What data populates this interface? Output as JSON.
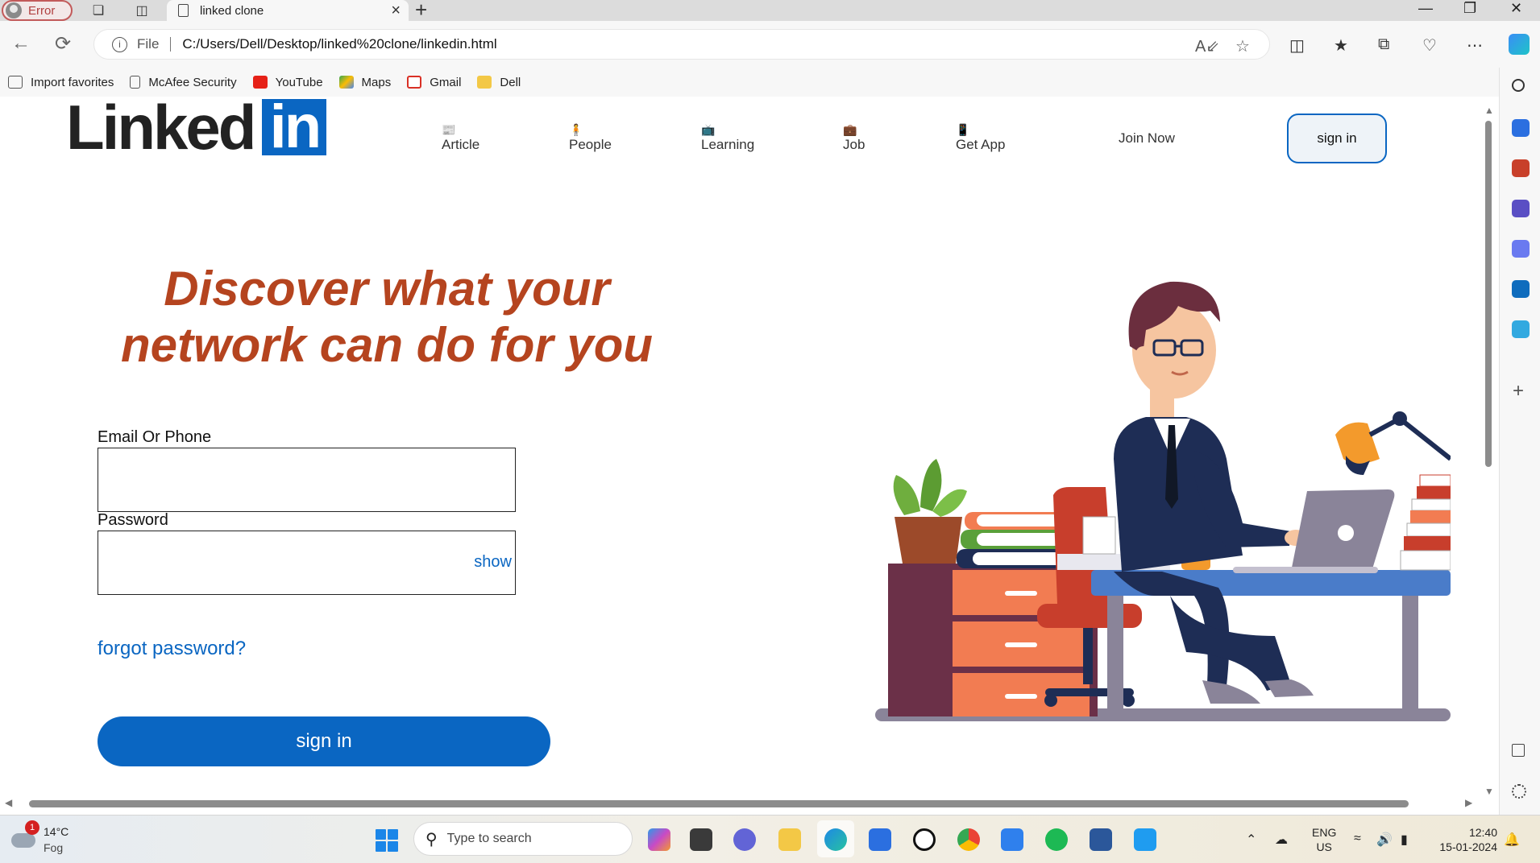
{
  "browser": {
    "profile_label": "Error",
    "tab_title": "linked clone",
    "address_prefix": "File",
    "url": "C:/Users/Dell/Desktop/linked%20clone/linkedin.html",
    "favorites": [
      {
        "label": "Import favorites",
        "icon": "import-icon",
        "color": "#555555"
      },
      {
        "label": "McAfee Security",
        "icon": "page-icon",
        "color": "#555555"
      },
      {
        "label": "YouTube",
        "icon": "youtube-icon",
        "color": "#e62117"
      },
      {
        "label": "Maps",
        "icon": "maps-icon",
        "color": "#34a853"
      },
      {
        "label": "Gmail",
        "icon": "gmail-icon",
        "color": "#d93025"
      },
      {
        "label": "Dell",
        "icon": "folder-icon",
        "color": "#f3c846"
      }
    ]
  },
  "page": {
    "logo_text": "Linked",
    "logo_badge": "in",
    "nav": [
      {
        "label": "Article",
        "icon": "article-icon"
      },
      {
        "label": "People",
        "icon": "person-icon"
      },
      {
        "label": "Learning",
        "icon": "learning-icon"
      },
      {
        "label": "Job",
        "icon": "briefcase-icon"
      },
      {
        "label": "Get App",
        "icon": "phone-icon"
      }
    ],
    "join_now": "Join Now",
    "sign_in_top": "sign in",
    "headline_line1": "Discover what your",
    "headline_line2": "network can do for you",
    "email_label": "Email Or Phone",
    "email_value": "",
    "password_label": "Password",
    "password_value": "",
    "show_label": "show",
    "forgot": "forgot password?",
    "sign_in_button": "sign in",
    "colors": {
      "brand": "#0a66c2",
      "headline": "#b5441f"
    }
  },
  "taskbar": {
    "weather_temp": "14°C",
    "weather_cond": "Fog",
    "weather_badge": "1",
    "search_placeholder": "Type to search",
    "lang_top": "ENG",
    "lang_bottom": "US",
    "time": "12:40",
    "date": "15-01-2024"
  }
}
